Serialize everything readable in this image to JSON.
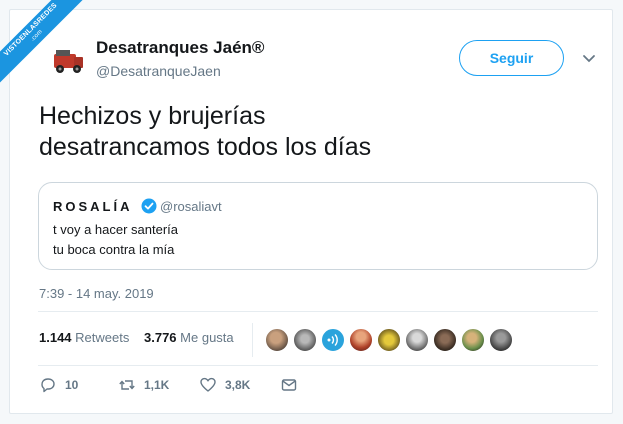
{
  "watermark": {
    "line1": "VISTOENLASREDES",
    "line2": ".com"
  },
  "author": {
    "display_name": "Desatranques Jaén®",
    "handle": "@DesatranqueJaen"
  },
  "follow_label": "Seguir",
  "tweet_text_line1": "Hechizos y brujerías",
  "tweet_text_line2": "desatrancamos todos los días",
  "quoted": {
    "name": "ROSALÍA",
    "handle": "@rosaliavt",
    "line1": "t voy a hacer santería",
    "line2": "tu boca contra la mía"
  },
  "timestamp": "7:39 - 14 may. 2019",
  "stats": {
    "retweets_count": "1.144",
    "retweets_label": "Retweets",
    "likes_count": "3.776",
    "likes_label": "Me gusta"
  },
  "actions": {
    "replies": "10",
    "retweets": "1,1K",
    "likes": "3,8K"
  },
  "colors": {
    "accent": "#1da1f2",
    "muted": "#657786",
    "verified": "#1da1f2"
  },
  "icons": [
    "chevron-down-icon",
    "verified-icon",
    "reply-icon",
    "retweet-icon",
    "like-icon",
    "dm-icon"
  ]
}
